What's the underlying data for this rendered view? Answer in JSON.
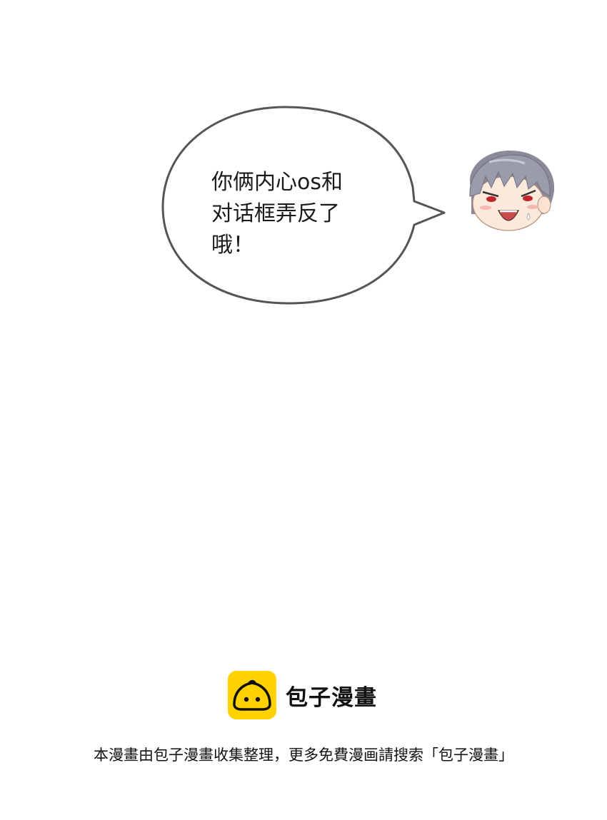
{
  "speech_bubble": {
    "lines": [
      "你俩内心os和",
      "对话框弄反了",
      "哦！"
    ]
  },
  "character": {
    "icon": "chibi-boy-face"
  },
  "watermark": {
    "logo_icon": "steamed-bun-icon",
    "brand_name": "包子漫畫",
    "brand_color": "#FFD200",
    "notice": "本漫畫由包子漫畫收集整理，更多免費漫画請搜索「包子漫畫」"
  }
}
